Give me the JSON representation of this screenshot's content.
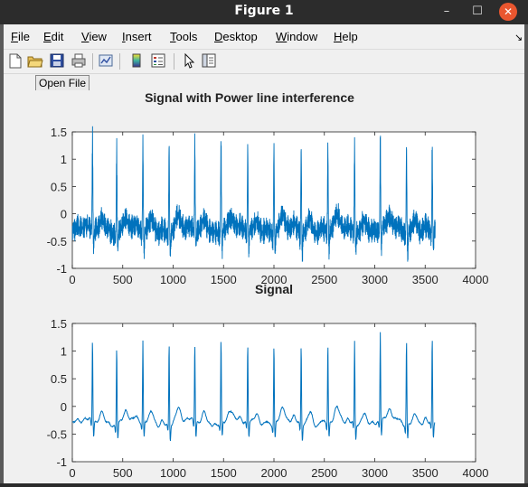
{
  "window": {
    "title": "Figure 1",
    "controls": {
      "minimize": "–",
      "maximize": "☐",
      "close": "✕"
    }
  },
  "menubar": {
    "items": [
      {
        "label": "File",
        "key": "F",
        "rest": "ile"
      },
      {
        "label": "Edit",
        "key": "E",
        "rest": "dit"
      },
      {
        "label": "View",
        "key": "V",
        "rest": "iew"
      },
      {
        "label": "Insert",
        "key": "I",
        "rest": "nsert"
      },
      {
        "label": "Tools",
        "key": "T",
        "rest": "ools"
      },
      {
        "label": "Desktop",
        "key": "D",
        "rest": "esktop"
      },
      {
        "label": "Window",
        "key": "W",
        "rest": "indow"
      },
      {
        "label": "Help",
        "key": "H",
        "rest": "elp"
      }
    ],
    "dock_arrow": "↘"
  },
  "toolbar": {
    "icons": [
      "new-figure-icon",
      "open-file-icon",
      "save-icon",
      "print-icon",
      "link-plot-icon",
      "colorbar-icon",
      "legend-icon",
      "pointer-icon",
      "property-inspector-icon"
    ],
    "tooltip": "Open File"
  },
  "colors": {
    "line": "#0072bd",
    "axes_bg": "#ffffff",
    "figure_bg": "#f0f0f0"
  },
  "chart_data": [
    {
      "type": "line",
      "title": "Signal with Power line interference",
      "xlim": [
        0,
        4000
      ],
      "ylim": [
        -1,
        1.5
      ],
      "xticks": [
        0,
        500,
        1000,
        1500,
        2000,
        2500,
        3000,
        3500,
        4000
      ],
      "yticks": [
        -1,
        -0.5,
        0,
        0.5,
        1,
        1.5
      ],
      "noise_amplitude": 0.17,
      "series": [
        {
          "x_range": [
            1,
            3600
          ],
          "baseline": -0.3,
          "beat_peaks_x": [
            200,
            440,
            700,
            960,
            1215,
            1475,
            1740,
            2000,
            2270,
            2535,
            2800,
            3055,
            3315,
            3570
          ],
          "beat_peaks_y": [
            1.37,
            1.23,
            1.29,
            1.35,
            1.25,
            1.34,
            1.22,
            1.26,
            1.26,
            1.22,
            1.26,
            1.35,
            1.26,
            1.21
          ],
          "trough_y": -0.65
        }
      ]
    },
    {
      "type": "line",
      "title": "Signal",
      "xlim": [
        0,
        4000
      ],
      "ylim": [
        -1,
        1.5
      ],
      "xticks": [
        0,
        500,
        1000,
        1500,
        2000,
        2500,
        3000,
        3500,
        4000
      ],
      "yticks": [
        -1,
        -0.5,
        0,
        0.5,
        1,
        1.5
      ],
      "noise_amplitude": 0.02,
      "series": [
        {
          "x_range": [
            1,
            3600
          ],
          "baseline": -0.3,
          "beat_peaks_x": [
            200,
            440,
            700,
            960,
            1215,
            1475,
            1740,
            2000,
            2270,
            2535,
            2800,
            3055,
            3315,
            3570
          ],
          "beat_peaks_y": [
            1.19,
            1.13,
            1.17,
            1.21,
            1.13,
            1.22,
            1.13,
            1.16,
            1.15,
            1.13,
            1.18,
            1.31,
            1.25,
            1.24
          ],
          "trough_y": -0.57
        }
      ]
    }
  ]
}
